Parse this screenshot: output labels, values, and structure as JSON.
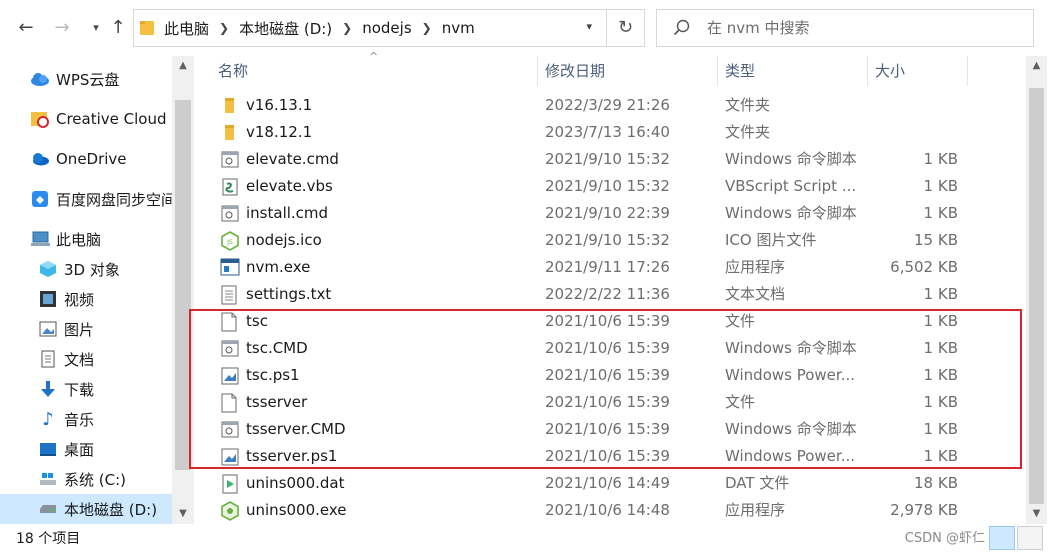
{
  "address_bar": {
    "crumbs": [
      "此电脑",
      "本地磁盘 (D:)",
      "nodejs",
      "nvm"
    ],
    "search_placeholder": "在 nvm 中搜索"
  },
  "sidebar": {
    "items": [
      {
        "label": "WPS云盘",
        "icon": "cloud-icon"
      },
      {
        "label": "Creative Cloud F",
        "icon": "creative-cloud-folder-icon"
      },
      {
        "label": "OneDrive",
        "icon": "onedrive-cloud-icon"
      },
      {
        "label": "百度网盘同步空间",
        "icon": "baidu-netdisk-icon"
      },
      {
        "label": "此电脑",
        "icon": "computer-icon"
      },
      {
        "label": "3D 对象",
        "icon": "3d-objects-icon"
      },
      {
        "label": "视频",
        "icon": "video-icon"
      },
      {
        "label": "图片",
        "icon": "pictures-icon"
      },
      {
        "label": "文档",
        "icon": "documents-icon"
      },
      {
        "label": "下载",
        "icon": "download-icon"
      },
      {
        "label": "音乐",
        "icon": "music-icon"
      },
      {
        "label": "桌面",
        "icon": "desktop-icon"
      },
      {
        "label": "系统 (C:)",
        "icon": "system-drive-icon"
      },
      {
        "label": "本地磁盘 (D:)",
        "icon": "local-drive-icon"
      }
    ]
  },
  "columns": {
    "name": "名称",
    "date": "修改日期",
    "type": "类型",
    "size": "大小"
  },
  "files": [
    {
      "name": "v16.13.1",
      "date": "2022/3/29 21:26",
      "type": "文件夹",
      "size": "",
      "icon": "folder-icon"
    },
    {
      "name": "v18.12.1",
      "date": "2023/7/13 16:40",
      "type": "文件夹",
      "size": "",
      "icon": "folder-icon"
    },
    {
      "name": "elevate.cmd",
      "date": "2021/9/10 15:32",
      "type": "Windows 命令脚本",
      "size": "1 KB",
      "icon": "cmd-script-icon"
    },
    {
      "name": "elevate.vbs",
      "date": "2021/9/10 15:32",
      "type": "VBScript Script ...",
      "size": "1 KB",
      "icon": "vbscript-icon"
    },
    {
      "name": "install.cmd",
      "date": "2021/9/10 22:39",
      "type": "Windows 命令脚本",
      "size": "1 KB",
      "icon": "cmd-script-icon"
    },
    {
      "name": "nodejs.ico",
      "date": "2021/9/10 15:32",
      "type": "ICO 图片文件",
      "size": "15 KB",
      "icon": "nodejs-icon"
    },
    {
      "name": "nvm.exe",
      "date": "2021/9/11 17:26",
      "type": "应用程序",
      "size": "6,502 KB",
      "icon": "exe-app-icon"
    },
    {
      "name": "settings.txt",
      "date": "2022/2/22 11:36",
      "type": "文本文档",
      "size": "1 KB",
      "icon": "text-file-icon"
    },
    {
      "name": "tsc",
      "date": "2021/10/6 15:39",
      "type": "文件",
      "size": "1 KB",
      "icon": "blank-file-icon"
    },
    {
      "name": "tsc.CMD",
      "date": "2021/10/6 15:39",
      "type": "Windows 命令脚本",
      "size": "1 KB",
      "icon": "cmd-script-icon"
    },
    {
      "name": "tsc.ps1",
      "date": "2021/10/6 15:39",
      "type": "Windows Power...",
      "size": "1 KB",
      "icon": "powershell-script-icon"
    },
    {
      "name": "tsserver",
      "date": "2021/10/6 15:39",
      "type": "文件",
      "size": "1 KB",
      "icon": "blank-file-icon"
    },
    {
      "name": "tsserver.CMD",
      "date": "2021/10/6 15:39",
      "type": "Windows 命令脚本",
      "size": "1 KB",
      "icon": "cmd-script-icon"
    },
    {
      "name": "tsserver.ps1",
      "date": "2021/10/6 15:39",
      "type": "Windows Power...",
      "size": "1 KB",
      "icon": "powershell-script-icon"
    },
    {
      "name": "unins000.dat",
      "date": "2021/10/6 14:49",
      "type": "DAT 文件",
      "size": "18 KB",
      "icon": "dat-file-icon"
    },
    {
      "name": "unins000.exe",
      "date": "2021/10/6 14:48",
      "type": "应用程序",
      "size": "2,978 KB",
      "icon": "nodejs-installer-icon"
    }
  ],
  "status": {
    "item_count": "18 个项目",
    "watermark": "CSDN @虾仁"
  },
  "colors": {
    "highlight": "#d8262c",
    "selected": "#cde8ff",
    "folder": "#f4c042"
  }
}
